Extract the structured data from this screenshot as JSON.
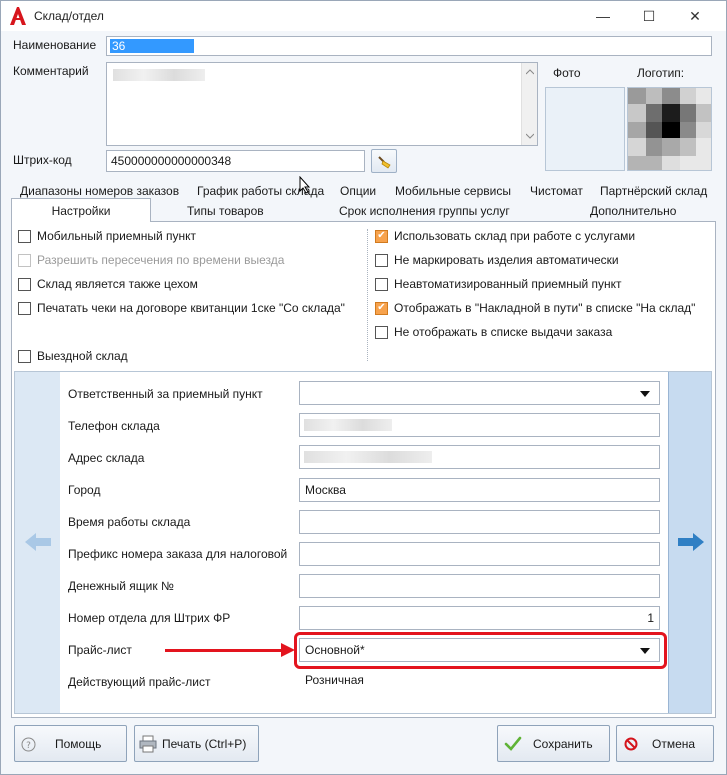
{
  "window": {
    "title": "Склад/отдел",
    "controls": {
      "minimize": "—",
      "maximize": "☐",
      "close": "✕"
    }
  },
  "form": {
    "name_label": "Наименование",
    "name_value": "36",
    "comment_label": "Комментарий",
    "barcode_label": "Штрих-код",
    "barcode_value": "450000000000000348",
    "photo_label": "Фото",
    "logo_label": "Логотип:"
  },
  "tabs_top": [
    "Диапазоны номеров заказов",
    "График работы склада",
    "Опции",
    "Мобильные сервисы",
    "Чистомат",
    "Партнёрский склад"
  ],
  "tabs_bottom": [
    "Настройки",
    "Типы товаров",
    "Срок исполнения группы услуг",
    "Дополнительно"
  ],
  "checkboxes_left": [
    {
      "label": "Мобильный приемный пункт",
      "checked": false,
      "disabled": false
    },
    {
      "label": "Разрешить пересечения по времени выезда",
      "checked": false,
      "disabled": true
    },
    {
      "label": "Склад является также цехом",
      "checked": false,
      "disabled": false
    },
    {
      "label": "Печатать чеки на договоре квитанции 1ске \"Со склада\"",
      "checked": false,
      "disabled": false
    },
    {
      "label": "Выездной склад",
      "checked": false,
      "disabled": false
    }
  ],
  "checkboxes_right": [
    {
      "label": "Использовать склад при работе с услугами",
      "checked": true
    },
    {
      "label": "Не маркировать изделия автоматически",
      "checked": false
    },
    {
      "label": "Неавтоматизированный приемный пункт",
      "checked": false
    },
    {
      "label": "Отображать в \"Накладной в пути\" в списке \"На склад\"",
      "checked": true
    },
    {
      "label": "Не отображать в списке выдачи заказа",
      "checked": false
    }
  ],
  "properties": {
    "responsible_label": "Ответственный за приемный пункт",
    "phone_label": "Телефон склада",
    "address_label": "Адрес склада",
    "city_label": "Город",
    "city_value": "Москва",
    "hours_label": "Время работы склада",
    "prefix_label": "Префикс номера заказа для налоговой",
    "cashbox_label": "Денежный ящик №",
    "dept_label": "Номер отдела для Штрих ФР",
    "dept_value": "1",
    "pricelist_label": "Прайс-лист",
    "pricelist_value": "Основной*",
    "active_pricelist_label": "Действующий прайс-лист",
    "active_pricelist_value": "Розничная"
  },
  "buttons": {
    "help": "Помощь",
    "print": "Печать (Ctrl+P)",
    "save": "Сохранить",
    "cancel": "Отмена"
  },
  "colors": {
    "checkbox_checked": "#f7a24c",
    "highlight": "#e3141e",
    "nav_arrow": "#2f7fc4"
  }
}
